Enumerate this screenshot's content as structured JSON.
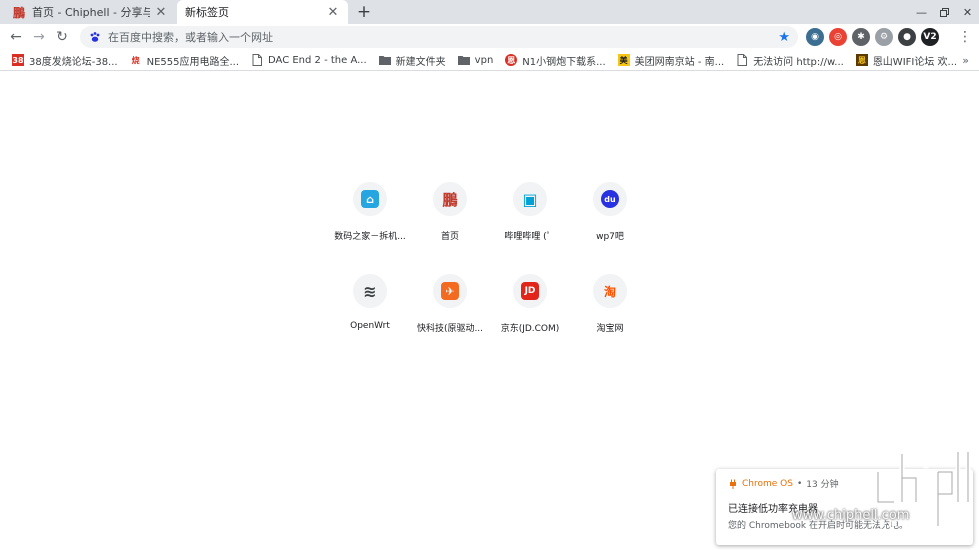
{
  "tabs": [
    {
      "title": "首页 - Chiphell - 分享与交流用户体验",
      "active": false
    },
    {
      "title": "新标签页",
      "active": true
    }
  ],
  "toolbar": {
    "omnibox_placeholder": "在百度中搜索，或者输入一个网址",
    "extensions": [
      "ext-globe-icon",
      "ext-target-icon",
      "ext-puzzle-icon",
      "ext-gear-icon",
      "ext-toggle-icon",
      "ext-v2-icon"
    ],
    "ext_v2_label": "V2"
  },
  "bookmarks": [
    {
      "label": "38度发烧论坛-38...",
      "icon": "38-site-icon",
      "icon_text": "38",
      "color": "#d93025"
    },
    {
      "label": "NE555应用电路全...",
      "icon": "ne555-site-icon",
      "icon_text": "烧",
      "color": "#ffffff"
    },
    {
      "label": "DAC End 2 - the A...",
      "icon": "page-icon",
      "icon_text": "",
      "color": "#ffffff"
    },
    {
      "label": "新建文件夹",
      "icon": "folder-icon",
      "icon_text": "",
      "color": "#ffffff"
    },
    {
      "label": "vpn",
      "icon": "folder-icon",
      "icon_text": "",
      "color": "#ffffff"
    },
    {
      "label": "N1小钢炮下载系...",
      "icon": "n1-site-icon",
      "icon_text": "恩",
      "color": "#d93025"
    },
    {
      "label": "美团网南京站 - 南...",
      "icon": "meituan-icon",
      "icon_text": "美",
      "color": "#f5c518"
    },
    {
      "label": "无法访问 http://w...",
      "icon": "page-icon",
      "icon_text": "",
      "color": "#ffffff"
    },
    {
      "label": "恩山WIFI论坛 欢...",
      "icon": "enshan-icon",
      "icon_text": "恩",
      "color": "#5b3a00"
    }
  ],
  "shortcuts": [
    {
      "label": "数码之家－拆机...",
      "icon": "mydigit-icon",
      "color": "#26a6e0",
      "glyph": "⌂"
    },
    {
      "label": "首页",
      "icon": "chiphell-icon",
      "color": "#c0392b",
      "glyph": "鵬"
    },
    {
      "label": "哔哩哔哩 (゜",
      "icon": "bilibili-icon",
      "color": "#00a1d6",
      "glyph": "▣"
    },
    {
      "label": "wp7吧",
      "icon": "baidu-paw-icon",
      "color": "#2932e1",
      "glyph": "du"
    },
    {
      "label": "OpenWrt",
      "icon": "openwrt-icon",
      "color": "#3c4043",
      "glyph": "≋"
    },
    {
      "label": "快科技(原驱动...",
      "icon": "mydrivers-icon",
      "color": "#f26b21",
      "glyph": "✈"
    },
    {
      "label": "京东(JD.COM)",
      "icon": "jd-icon",
      "color": "#e1251b",
      "glyph": "JD"
    },
    {
      "label": "淘宝网",
      "icon": "taobao-icon",
      "color": "#ff5000",
      "glyph": "淘"
    }
  ],
  "notification": {
    "app": "Chrome OS",
    "separator": "•",
    "time": "13 分钟",
    "title": "已连接低功率充电器",
    "body": "您的 Chromebook 在开启时可能无法充电。"
  },
  "watermark": {
    "url": "www.chiphell.com"
  },
  "colors": {
    "tabstrip_bg": "#dee1e6",
    "accent_blue": "#1a73e8",
    "omnibox_bg": "#f1f3f4"
  }
}
